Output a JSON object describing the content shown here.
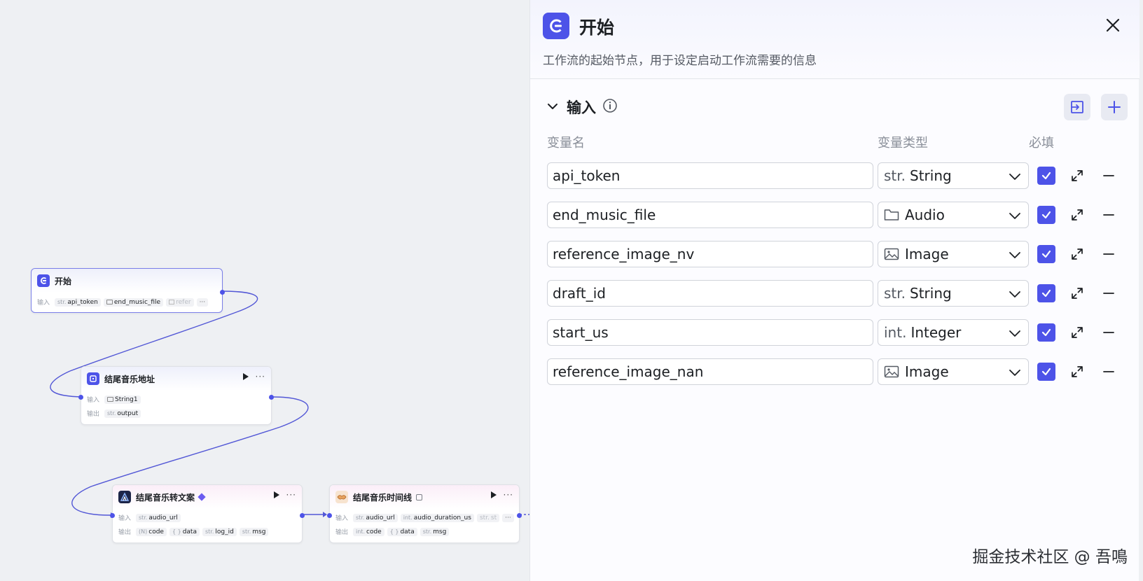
{
  "canvas": {
    "nodes": {
      "start": {
        "title": "开始",
        "input_label": "输入",
        "inputs": [
          {
            "type": "str.",
            "name": "api_token"
          },
          {
            "type": "",
            "name": "end_music_file"
          },
          {
            "type": "",
            "name": "refer"
          }
        ],
        "more": "···"
      },
      "end_music_url": {
        "title": "结尾音乐地址",
        "input_label": "输入",
        "output_label": "输出",
        "inputs": [
          {
            "type": "",
            "name": "String1"
          }
        ],
        "outputs": [
          {
            "type": "str.",
            "name": "output"
          }
        ],
        "more": "···"
      },
      "to_text": {
        "title": "结尾音乐转文案",
        "input_label": "输入",
        "output_label": "输出",
        "inputs": [
          {
            "type": "str.",
            "name": "audio_url"
          }
        ],
        "outputs": [
          {
            "type": "(N)",
            "name": "code"
          },
          {
            "type": "{ }",
            "name": "data"
          },
          {
            "type": "str.",
            "name": "log_id"
          },
          {
            "type": "str.",
            "name": "msg"
          }
        ],
        "more": "···"
      },
      "timeline": {
        "title": "结尾音乐时间线",
        "input_label": "输入",
        "output_label": "输出",
        "inputs": [
          {
            "type": "str.",
            "name": "audio_url"
          },
          {
            "type": "int.",
            "name": "audio_duration_us"
          },
          {
            "type": "str.",
            "name": "st"
          }
        ],
        "outputs": [
          {
            "type": "int.",
            "name": "code"
          },
          {
            "type": "{ }",
            "name": "data"
          },
          {
            "type": "str.",
            "name": "msg"
          }
        ],
        "more": "···"
      }
    }
  },
  "panel": {
    "title": "开始",
    "description": "工作流的起始节点，用于设定启动工作流需要的信息",
    "section_title": "输入",
    "columns": {
      "name": "变量名",
      "type": "变量类型",
      "required": "必填"
    },
    "variables": [
      {
        "name": "api_token",
        "type_icon": "str-icon",
        "type_prefix": "str.",
        "type": "String",
        "required": true
      },
      {
        "name": "end_music_file",
        "type_icon": "folder-icon",
        "type_prefix": "",
        "type": "Audio",
        "required": true
      },
      {
        "name": "reference_image_nv",
        "type_icon": "image-icon",
        "type_prefix": "",
        "type": "Image",
        "required": true
      },
      {
        "name": "draft_id",
        "type_icon": "str-icon",
        "type_prefix": "str.",
        "type": "String",
        "required": true
      },
      {
        "name": "start_us",
        "type_icon": "int-icon",
        "type_prefix": "int.",
        "type": "Integer",
        "required": true
      },
      {
        "name": "reference_image_nan",
        "type_icon": "image-icon",
        "type_prefix": "",
        "type": "Image",
        "required": true
      }
    ]
  },
  "watermark": "掘金技术社区 @ 吾鳴",
  "colors": {
    "accent": "#4d53e8",
    "edge": "#5257d6",
    "canvas_bg": "#eef0f3"
  }
}
